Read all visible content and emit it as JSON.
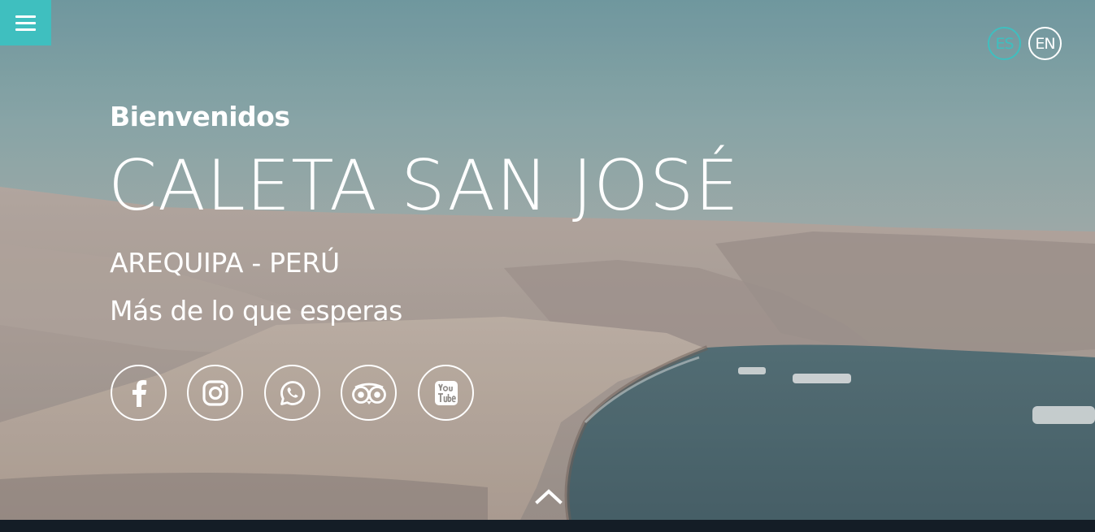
{
  "menu": {
    "icon": "hamburger-menu-icon"
  },
  "languages": [
    {
      "code": "ES",
      "active": true,
      "color": "#3fbfbf"
    },
    {
      "code": "EN",
      "active": false,
      "color": "#ffffff"
    }
  ],
  "hero": {
    "welcome": "Bienvenidos",
    "title": "CALETA SAN JOSÉ",
    "region": "AREQUIPA - PERÚ",
    "tagline": "Más de lo que esperas"
  },
  "social": [
    {
      "name": "facebook-icon"
    },
    {
      "name": "instagram-icon"
    },
    {
      "name": "whatsapp-icon"
    },
    {
      "name": "tripadvisor-icon"
    },
    {
      "name": "youtube-icon"
    }
  ],
  "scroll": {
    "icon": "chevron-up-icon"
  },
  "colors": {
    "accent": "#3fbfbf",
    "text": "#ffffff",
    "footer": "#141d26"
  }
}
